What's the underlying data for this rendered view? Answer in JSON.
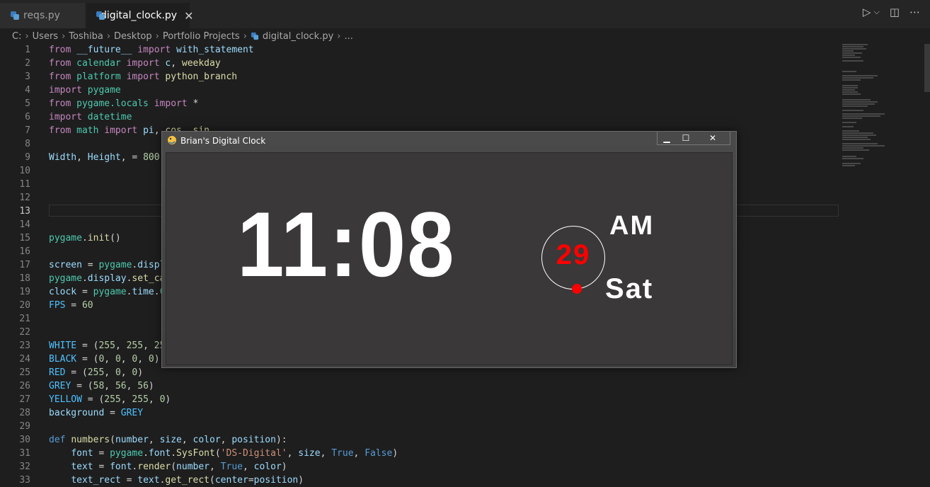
{
  "tabs": [
    {
      "label": "reqs.py"
    },
    {
      "label": "digital_clock.py",
      "close": "✕"
    }
  ],
  "toolbar": {
    "run": "▷",
    "dropdown": "⌵",
    "split": "◫",
    "more": "⋯"
  },
  "breadcrumb": [
    "C:",
    "Users",
    "Toshiba",
    "Desktop",
    "Portfolio Projects",
    "digital_clock.py",
    "..."
  ],
  "pygame_window": {
    "title": "Brian's Digital Clock",
    "controls": {
      "minimize": "▁",
      "maximize": "☐",
      "close": "✕"
    },
    "time": "11:08",
    "ampm": "AM",
    "day_number": "29",
    "day_name": "Sat",
    "colors": {
      "digits": "#ffffff",
      "accent": "#ff0000",
      "background": "#3a3838"
    }
  },
  "editor": {
    "active_line": "13"
  }
}
